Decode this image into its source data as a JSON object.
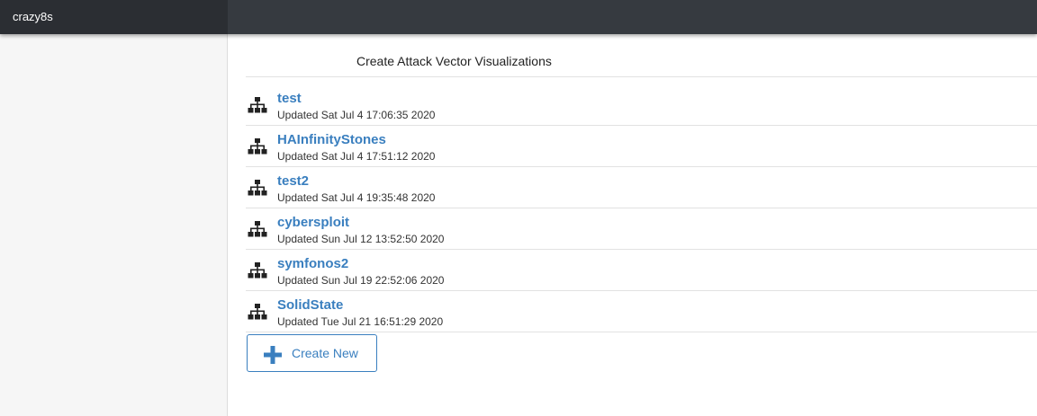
{
  "app": {
    "brand": "crazy8s"
  },
  "main": {
    "title": "Create Attack Vector Visualizations",
    "items": [
      {
        "name": "test",
        "updated": "Updated Sat Jul 4 17:06:35 2020",
        "icon": "hierarchy-icon"
      },
      {
        "name": "HAInfinityStones",
        "updated": "Updated Sat Jul 4 17:51:12 2020",
        "icon": "hierarchy-icon"
      },
      {
        "name": "test2",
        "updated": "Updated Sat Jul 4 19:35:48 2020",
        "icon": "hierarchy-icon"
      },
      {
        "name": "cybersploit",
        "updated": "Updated Sun Jul 12 13:52:50 2020",
        "icon": "hierarchy-icon"
      },
      {
        "name": "symfonos2",
        "updated": "Updated Sun Jul 19 22:52:06 2020",
        "icon": "hierarchy-icon"
      },
      {
        "name": "SolidState",
        "updated": "Updated Tue Jul 21 16:51:29 2020",
        "icon": "hierarchy-icon"
      }
    ],
    "create_button": {
      "label": "Create New",
      "icon": "plus-icon"
    }
  },
  "colors": {
    "topbar": "#363a40",
    "brand_bg": "#2b2e33",
    "link": "#3a7fbf",
    "sidebar": "#f6f6f6"
  }
}
